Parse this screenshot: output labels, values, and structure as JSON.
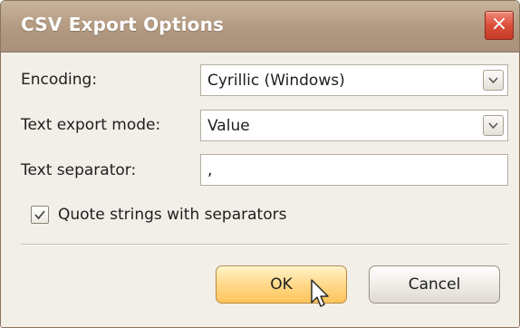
{
  "dialog": {
    "title": "CSV Export Options",
    "close_icon": "×"
  },
  "fields": {
    "encoding": {
      "label": "Encoding:",
      "value": "Cyrillic (Windows)"
    },
    "text_export_mode": {
      "label": "Text export mode:",
      "value": "Value"
    },
    "text_separator": {
      "label": "Text separator:",
      "value": ","
    }
  },
  "quote_strings": {
    "label": "Quote strings with separators",
    "checked": true
  },
  "buttons": {
    "ok": "OK",
    "cancel": "Cancel"
  },
  "colors": {
    "titlebar": "#b29980",
    "close_button": "#db4f3a",
    "ok_button": "#ffd98a",
    "dialog_background": "#f2efe8"
  },
  "icons": [
    "close-icon",
    "chevron-down-icon",
    "checkmark-icon",
    "mouse-pointer-icon"
  ]
}
